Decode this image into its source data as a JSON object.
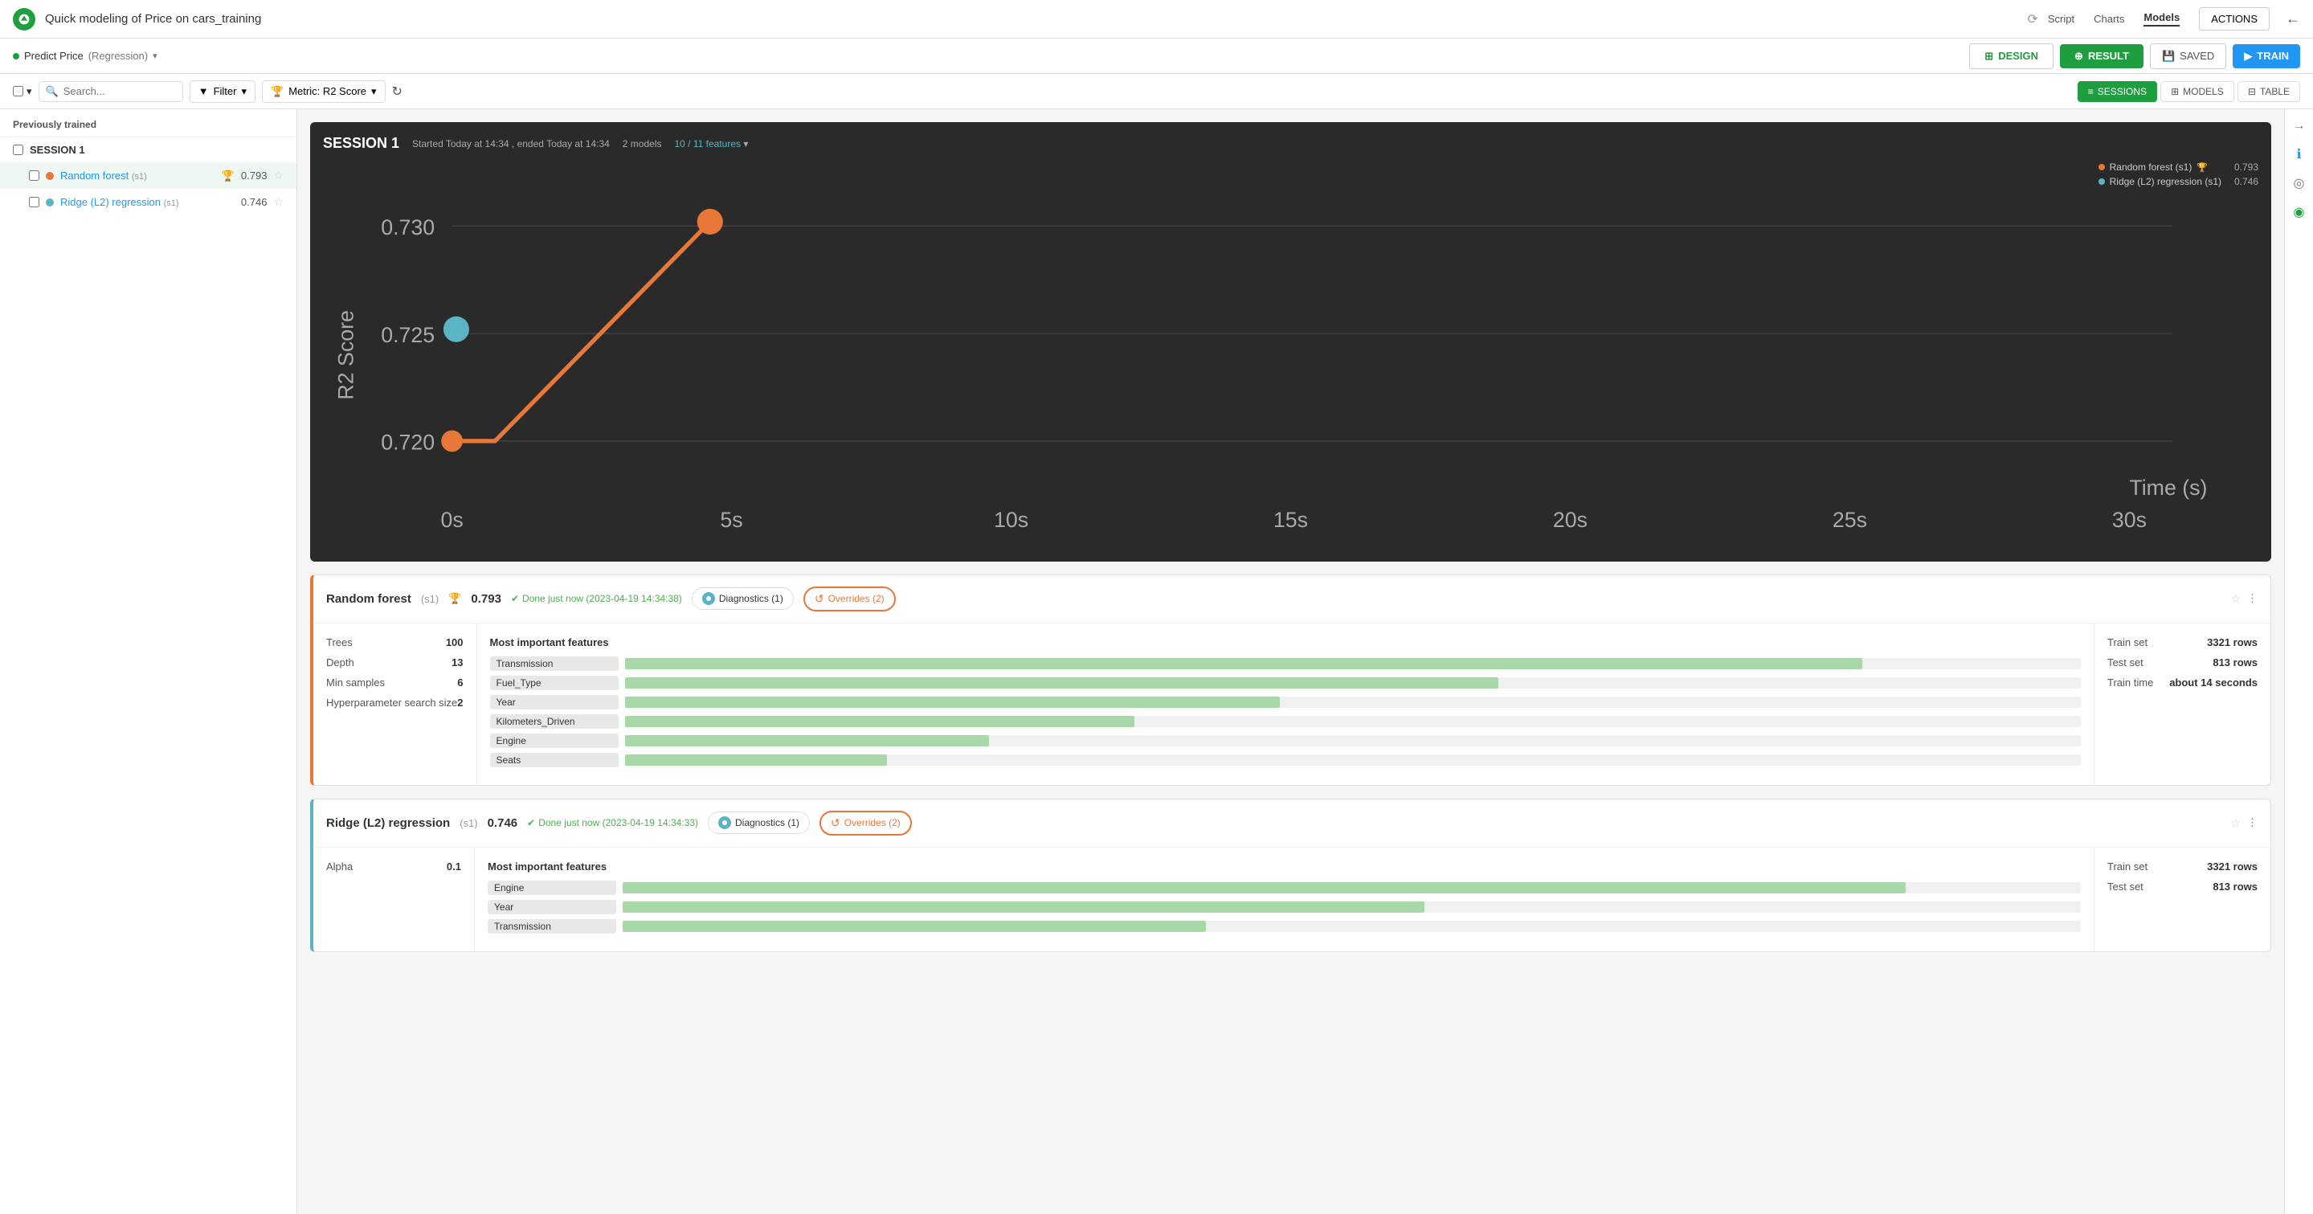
{
  "app": {
    "title": "Quick modeling of Price on cars_training",
    "sync_icon": "sync"
  },
  "top_nav": {
    "script_label": "Script",
    "charts_label": "Charts",
    "models_label": "Models",
    "actions_label": "ACTIONS",
    "back_icon": "←"
  },
  "sub_nav": {
    "predict_label": "Predict Price",
    "predict_type": "(Regression)",
    "design_label": "DESIGN",
    "result_label": "RESULT",
    "saved_label": "SAVED",
    "train_label": "TRAIN"
  },
  "toolbar": {
    "search_placeholder": "Search...",
    "filter_label": "Filter",
    "metric_label": "Metric: R2 Score",
    "sessions_label": "SESSIONS",
    "models_label": "MODELS",
    "table_label": "TABLE"
  },
  "sidebar": {
    "section_label": "Previously trained",
    "session_label": "SESSION 1",
    "models": [
      {
        "name": "Random forest",
        "session": "s1",
        "score": "0.793",
        "color": "orange",
        "starred": false
      },
      {
        "name": "Ridge (L2) regression",
        "session": "s1",
        "score": "0.746",
        "color": "teal",
        "starred": false
      }
    ]
  },
  "session_card": {
    "session_number": "SESSION 1",
    "meta": "Started Today at 14:34 , ended Today at 14:34",
    "models_count": "2 models",
    "features": "10 / 11 features",
    "legend": [
      {
        "label": "Random forest (s1)",
        "color": "#e8773a",
        "score": "0.793",
        "trophy": true
      },
      {
        "label": "Ridge (L2) regression (s1)",
        "color": "#5ab4c5",
        "score": "0.746",
        "trophy": false
      }
    ],
    "y_axis_label": "R2 Score",
    "x_axis_label": "Time (s)",
    "y_ticks": [
      "0.730",
      "0.720"
    ],
    "x_ticks": [
      "0s",
      "5s",
      "10s",
      "15s",
      "20s",
      "25s",
      "30s"
    ]
  },
  "model_cards": [
    {
      "id": "random-forest",
      "name": "Random forest",
      "session": "s1",
      "score": "0.793",
      "status": "Done just now (2023-04-19 14:34:38)",
      "diagnostics_label": "Diagnostics (1)",
      "overrides_label": "Overrides (2)",
      "color_class": "random-forest",
      "params": [
        {
          "label": "Trees",
          "value": "100"
        },
        {
          "label": "Depth",
          "value": "13"
        },
        {
          "label": "Min samples",
          "value": "6"
        },
        {
          "label": "Hyperparameter search size",
          "value": "2"
        }
      ],
      "features_title": "Most important features",
      "features": [
        {
          "name": "Transmission",
          "pct": 85
        },
        {
          "name": "Fuel_Type",
          "pct": 60
        },
        {
          "name": "Year",
          "pct": 45
        },
        {
          "name": "Kilometers_Driven",
          "pct": 35
        },
        {
          "name": "Engine",
          "pct": 25
        },
        {
          "name": "Seats",
          "pct": 18
        }
      ],
      "stats": [
        {
          "label": "Train set",
          "value": "3321 rows"
        },
        {
          "label": "Test set",
          "value": "813 rows"
        },
        {
          "label": "Train time",
          "value": "about 14 seconds"
        }
      ]
    },
    {
      "id": "ridge",
      "name": "Ridge (L2) regression",
      "session": "s1",
      "score": "0.746",
      "status": "Done just now (2023-04-19 14:34:33)",
      "diagnostics_label": "Diagnostics (1)",
      "overrides_label": "Overrides (2)",
      "color_class": "ridge",
      "params": [
        {
          "label": "Alpha",
          "value": "0.1"
        }
      ],
      "features_title": "Most important features",
      "features": [
        {
          "name": "Engine",
          "pct": 88
        },
        {
          "name": "Year",
          "pct": 55
        },
        {
          "name": "Transmission",
          "pct": 40
        }
      ],
      "stats": [
        {
          "label": "Train set",
          "value": "3321 rows"
        },
        {
          "label": "Test set",
          "value": "813 rows"
        }
      ]
    }
  ]
}
